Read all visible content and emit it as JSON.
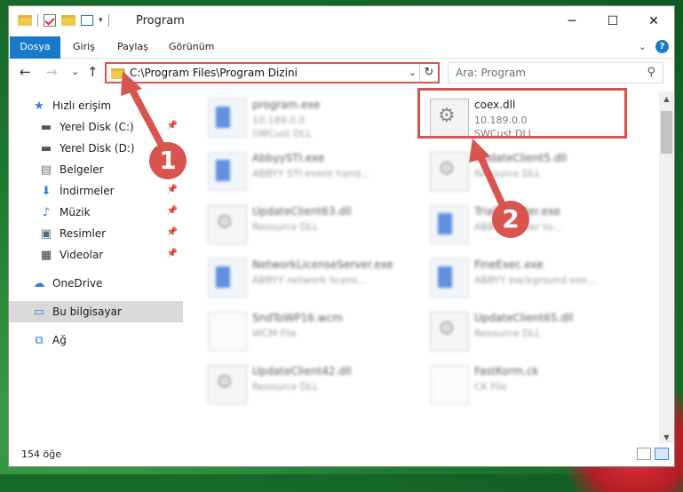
{
  "window": {
    "title": "Program",
    "controls": {
      "minimize": "─",
      "maximize": "☐",
      "close": "✕"
    }
  },
  "ribbon": {
    "tabs": [
      {
        "label": "Dosya"
      },
      {
        "label": "Giriş"
      },
      {
        "label": "Paylaş"
      },
      {
        "label": "Görünüm"
      }
    ],
    "expand": "⌄",
    "help": "?"
  },
  "nav": {
    "back": "←",
    "forward": "→",
    "recent": "⌄",
    "up": "↑",
    "address": "C:\\Program Files\\Program Dizini",
    "address_dropdown": "⌄",
    "refresh": "↻",
    "search_placeholder": "Ara: Program",
    "search_icon": "⚲"
  },
  "sidebar": {
    "items": [
      {
        "label": "Hızlı erişim",
        "icon": "star-icon"
      },
      {
        "label": "Yerel Disk (C:)",
        "icon": "drive-icon",
        "pinned": true
      },
      {
        "label": "Yerel Disk (D:)",
        "icon": "drive-icon"
      },
      {
        "label": "Belgeler",
        "icon": "documents-icon",
        "pinned": true
      },
      {
        "label": "İndirmeler",
        "icon": "download-icon",
        "pinned": true
      },
      {
        "label": "Müzik",
        "icon": "music-icon",
        "pinned": true
      },
      {
        "label": "Resimler",
        "icon": "pictures-icon",
        "pinned": true
      },
      {
        "label": "Videolar",
        "icon": "video-icon",
        "pinned": true
      },
      {
        "label": "OneDrive",
        "icon": "cloud-icon"
      },
      {
        "label": "Bu bilgisayar",
        "icon": "computer-icon",
        "selected": true
      },
      {
        "label": "Ağ",
        "icon": "network-icon"
      }
    ]
  },
  "files": [
    {
      "name": "program.exe",
      "line1": "10.189.0.0",
      "line2": "SWCust DLL",
      "icon": "app-icon",
      "blurred": true
    },
    {
      "name": "coex.dll",
      "line1": "10.189.0.0",
      "line2": "SWCust DLL",
      "icon": "dll-icon",
      "blurred": false,
      "highlighted": true
    },
    {
      "name": "AbbyySTI.exe",
      "line1": "ABBYY STI event hand...",
      "line2": "",
      "icon": "app-icon",
      "blurred": true
    },
    {
      "name": "UpdateClient5.dll",
      "line1": "Resource DLL",
      "line2": "",
      "icon": "dll-icon",
      "blurred": true
    },
    {
      "name": "UpdateClient63.dll",
      "line1": "Resource DLL",
      "line2": "",
      "icon": "dll-icon",
      "blurred": true
    },
    {
      "name": "TrialInstaller.exe",
      "line1": "ABBYY loader to...",
      "line2": "",
      "icon": "app-icon",
      "blurred": true
    },
    {
      "name": "NetworkLicenseServer.exe",
      "line1": "ABBYY network licens...",
      "line2": "",
      "icon": "app-icon",
      "blurred": true
    },
    {
      "name": "FineExec.exe",
      "line1": "ABBYY background exe...",
      "line2": "",
      "icon": "app-icon",
      "blurred": true
    },
    {
      "name": "SndToWP16.wcm",
      "line1": "WCM File",
      "line2": "",
      "icon": "doc-icon",
      "blurred": true
    },
    {
      "name": "UpdateClient65.dll",
      "line1": "Resource DLL",
      "line2": "",
      "icon": "dll-icon",
      "blurred": true
    },
    {
      "name": "UpdateClient42.dll",
      "line1": "Resource DLL",
      "line2": "",
      "icon": "dll-icon",
      "blurred": true
    },
    {
      "name": "FastKorm.ck",
      "line1": "CK File",
      "line2": "",
      "icon": "doc-icon",
      "blurred": true
    }
  ],
  "status": {
    "count": "154 öğe"
  },
  "annotations": {
    "callout_1": "1",
    "callout_2": "2",
    "color": "#d9534f"
  },
  "colors": {
    "accent": "#1979ca",
    "highlight": "#d9534f",
    "selection": "#d9d9d9"
  }
}
